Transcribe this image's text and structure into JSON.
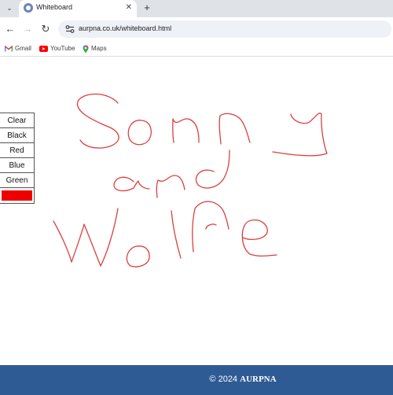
{
  "browser": {
    "tab_title": "Whiteboard",
    "url": "aurpna.co.uk/whiteboard.html",
    "bookmarks": [
      {
        "label": "Gmail",
        "icon": "gmail-icon"
      },
      {
        "label": "YouTube",
        "icon": "youtube-icon"
      },
      {
        "label": "Maps",
        "icon": "maps-icon"
      }
    ]
  },
  "tools": {
    "clear": "Clear",
    "black": "Black",
    "red": "Red",
    "blue": "Blue",
    "green": "Green",
    "current_color": "#ee0000"
  },
  "drawing": {
    "ink_color": "#d9413f",
    "handwritten_text": [
      "Sonny",
      "and",
      "Wolfe"
    ]
  },
  "footer": {
    "copyright": "© 2024",
    "brand": "AURPNA"
  },
  "colors": {
    "footer_bg": "#2f5b95",
    "tabstrip_bg": "#dfe3e8"
  }
}
